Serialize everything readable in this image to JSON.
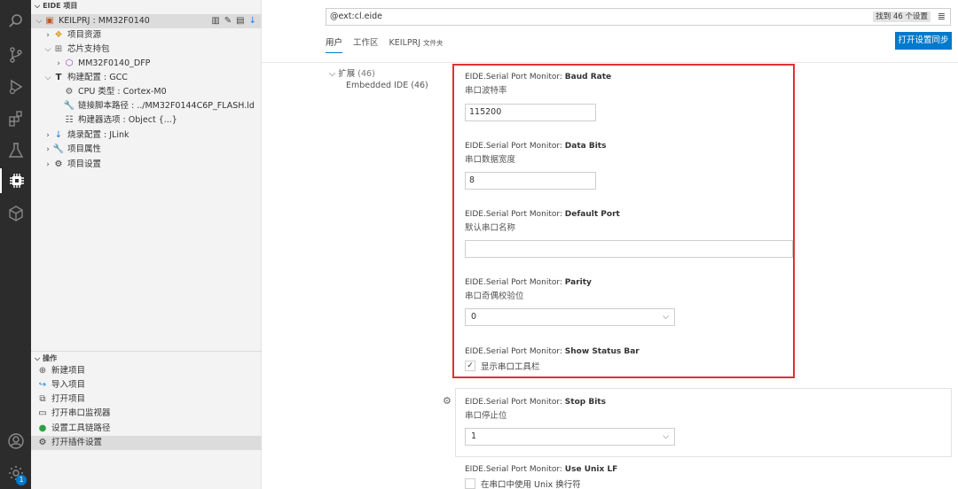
{
  "sidebar": {
    "section_title": "EIDE 项目",
    "root": {
      "label": "KEILPRJ : MM32F0140"
    },
    "tree": [
      {
        "label": "项目资源"
      },
      {
        "label": "芯片支持包"
      },
      {
        "label": "MM32F0140_DFP"
      },
      {
        "label": "构建配置 : GCC"
      },
      {
        "label": "CPU 类型 : Cortex-M0"
      },
      {
        "label": "链接脚本路径 : ../MM32F0144C6P_FLASH.ld"
      },
      {
        "label": "构建器选项 : Object {...}"
      },
      {
        "label": "烧录配置 : JLink"
      },
      {
        "label": "项目属性"
      },
      {
        "label": "项目设置"
      }
    ],
    "ops_title": "操作",
    "ops": [
      {
        "label": "新建项目"
      },
      {
        "label": "导入项目"
      },
      {
        "label": "打开项目"
      },
      {
        "label": "打开串口监视器"
      },
      {
        "label": "设置工具链路径"
      },
      {
        "label": "打开插件设置"
      }
    ]
  },
  "activity": {
    "badge": "1"
  },
  "settings": {
    "search_value": "@ext:cl.eide",
    "search_count": "找到 46 个设置",
    "tabs": [
      {
        "label": "用户"
      },
      {
        "label": "工作区"
      },
      {
        "label": "KEILPRJ",
        "suffix": "文件夹"
      }
    ],
    "sync_button": "打开设置同步",
    "toc": {
      "ext_label": "扩展",
      "ext_count": "(46)",
      "sub_label": "Embedded IDE",
      "sub_count": "(46)"
    },
    "items": [
      {
        "prefix": "EIDE.Serial Port Monitor: ",
        "name": "Baud Rate",
        "desc": "串口波特率",
        "value": "115200"
      },
      {
        "prefix": "EIDE.Serial Port Monitor: ",
        "name": "Data Bits",
        "desc": "串口数据宽度",
        "value": "8"
      },
      {
        "prefix": "EIDE.Serial Port Monitor: ",
        "name": "Default Port",
        "desc": "默认串口名称",
        "value": ""
      },
      {
        "prefix": "EIDE.Serial Port Monitor: ",
        "name": "Parity",
        "desc": "串口奇偶校验位",
        "value": "0"
      },
      {
        "prefix": "EIDE.Serial Port Monitor: ",
        "name": "Show Status Bar",
        "desc": "显示串口工具栏",
        "checked": true
      },
      {
        "prefix": "EIDE.Serial Port Monitor: ",
        "name": "Stop Bits",
        "desc": "串口停止位",
        "value": "1"
      },
      {
        "prefix": "EIDE.Serial Port Monitor: ",
        "name": "Use Unix LF",
        "desc": "在串口中使用 Unix 换行符",
        "checked": false
      }
    ]
  }
}
